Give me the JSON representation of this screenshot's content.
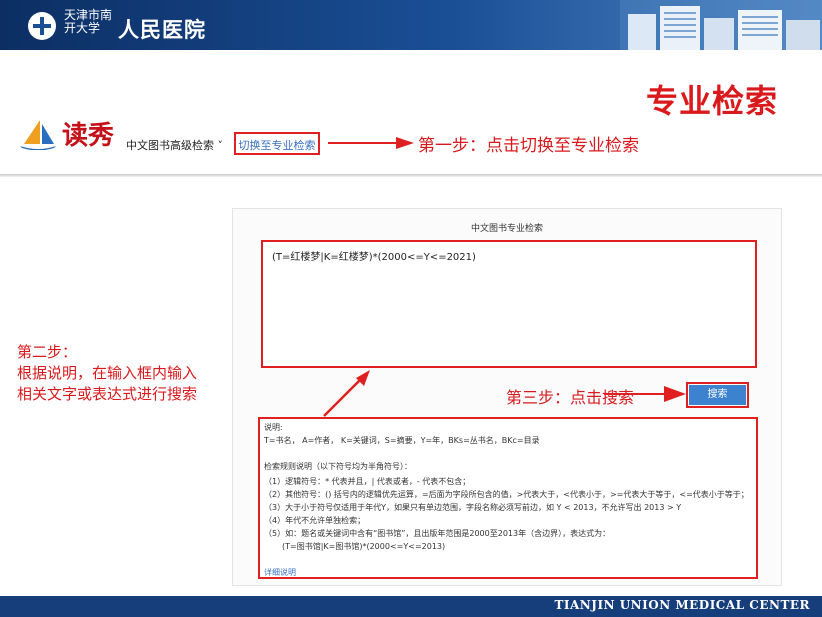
{
  "header": {
    "hosp_small": "天津市南开大学",
    "hosp_big": "人民医院"
  },
  "slide_title": "专业检索",
  "duxiu": {
    "name": "读秀",
    "search_mode": "中文图书高级检索 ˅",
    "switch_label": "切换至专业检索"
  },
  "steps": {
    "step1": "第一步：点击切换至专业检索",
    "step2_line1": "第二步：",
    "step2_line2": "根据说明，在输入框内输入",
    "step2_line3": "相关文字或表达式进行搜索",
    "step3": "第三步：点击搜索"
  },
  "panel": {
    "title": "中文图书专业检索",
    "query": "(T=红楼梦|K=红楼梦)*(2000<=Y<=2021)",
    "search_button": "搜索"
  },
  "help": {
    "heading": "说明:",
    "fields": "T=书名， A=作者， K=关键词，S=摘要，Y=年，BKs=丛书名，BKc=目录",
    "rules_heading": "检索规则说明（以下符号均为半角符号）：",
    "rule1": "（1）逻辑符号：* 代表并且，| 代表或者，- 代表不包含；",
    "rule2": "（2）其他符号：() 括号内的逻辑优先运算，=后面为字段所包含的值，>代表大于，<代表小于，>=代表大于等于，<=代表小于等于；",
    "rule3": "（3）大于小于符号仅适用于年代Y，如果只有单边范围，字段名称必须写前边，如 Y < 2013，不允许写出 2013 > Y",
    "rule4": "（4）年代不允许单独检索；",
    "rule5": "（5）如：题名或关键词中含有“图书馆”，且出版年范围是2000至2013年（含边界），表达式为：",
    "example": "(T=图书馆|K=图书馆)*(2000<=Y<=2013)",
    "more_link": "详细说明"
  },
  "footer": {
    "text": "TIANJIN UNION MEDICAL CENTER"
  },
  "colors": {
    "header_blue": "#1a4f96",
    "accent_red": "#d9191c",
    "button_blue": "#3c82cf"
  }
}
